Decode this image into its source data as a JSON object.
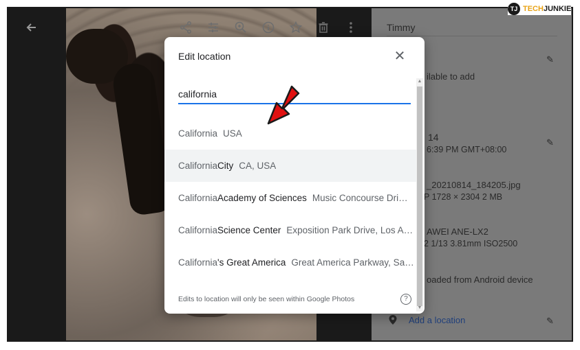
{
  "panel": {
    "name": "Timmy",
    "description_hint": "ilable to add",
    "date": "14",
    "time": "6:39 PM   GMT+08:00",
    "filename": "_20210814_184205.jpg",
    "file_meta": "P   1728 × 2304   2 MB",
    "device": "AWEI ANE-LX2",
    "camera_meta": "2   1/13   3.81mm   ISO2500",
    "upload": "oaded from Android device",
    "add_location": "Add a location"
  },
  "dialog": {
    "title": "Edit location",
    "search_value": "california",
    "results": [
      {
        "match": "California",
        "rest": "",
        "secondary": "USA"
      },
      {
        "match": "California",
        "rest": " City",
        "secondary": "CA, USA"
      },
      {
        "match": "California",
        "rest": " Academy of Sciences",
        "secondary": "Music Concourse Dri…"
      },
      {
        "match": "California",
        "rest": " Science Center",
        "secondary": "Exposition Park Drive, Los A…"
      },
      {
        "match": "California",
        "rest": "'s Great America",
        "secondary": "Great America Parkway, Sa…"
      }
    ],
    "footer": "Edits to location will only be seen within Google Photos",
    "help_glyph": "?",
    "close_glyph": "✕"
  },
  "logo": {
    "mark": "TJ",
    "tech": "TECH",
    "junkie": "JUNKIE"
  },
  "icons": {
    "back": "←",
    "share": "share-icon",
    "edit": "tune-icon",
    "zoom": "zoom-icon",
    "info": "info-icon",
    "favorite": "star-icon",
    "delete": "trash-icon",
    "more": "more-vert-icon"
  },
  "colors": {
    "accent": "#1a73e8",
    "arrow": "#e01010",
    "logo_orange": "#e8a317"
  }
}
